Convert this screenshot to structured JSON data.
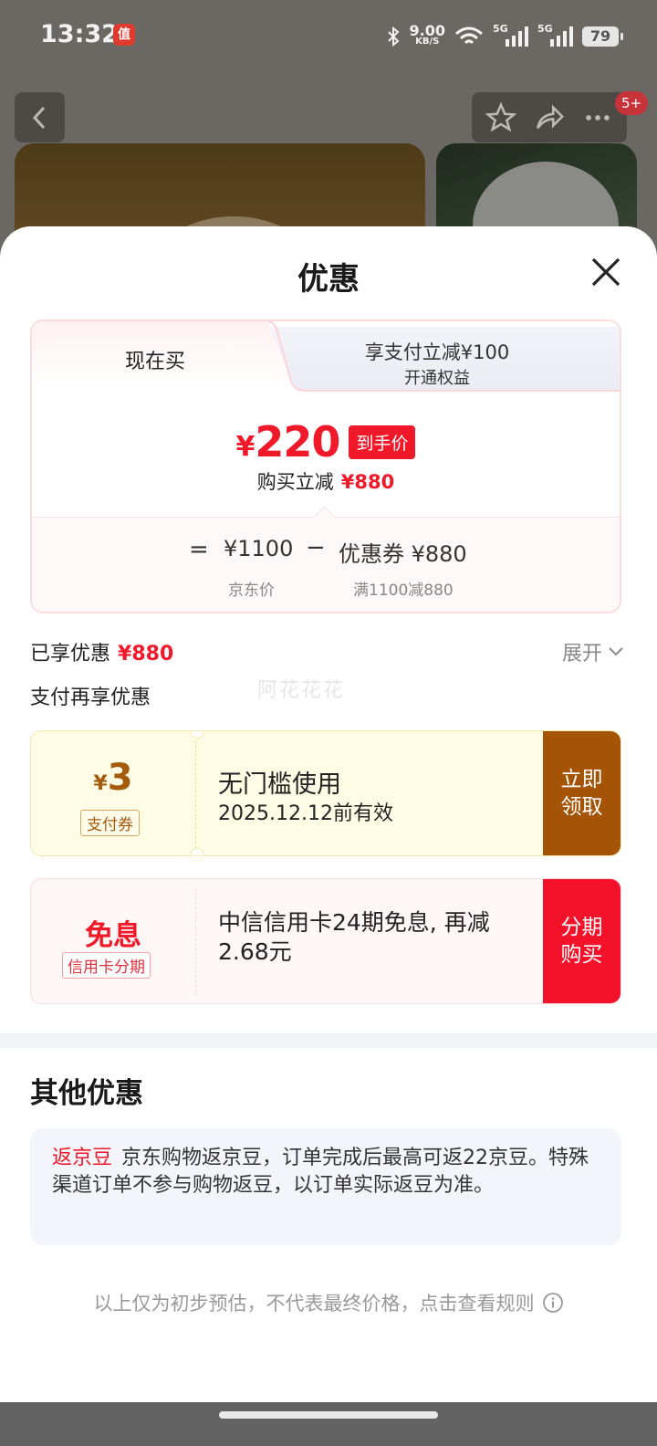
{
  "status_bar": {
    "time": "13:32",
    "app_icon_glyph": "值",
    "net_speed_value": "9.00",
    "net_speed_unit": "KB/S",
    "signal_1_label": "5G",
    "signal_2_label": "5G",
    "battery": "79"
  },
  "background": {
    "cart_badge": "5+"
  },
  "sheet": {
    "title": "优惠",
    "tabs": {
      "active_label": "现在买",
      "inactive_main": "享支付立减¥100",
      "inactive_sub": "开通权益"
    },
    "price": {
      "currency": "¥",
      "amount": "220",
      "tag": "到手价",
      "reduce_label": "购买立减",
      "reduce_amount": "¥880"
    },
    "formula": {
      "equals": "=",
      "jd_price": "¥1100",
      "minus": "−",
      "coupon": "优惠券 ¥880",
      "jd_price_label": "京东价",
      "coupon_label": "满1100减880"
    },
    "enjoyed_label": "已享优惠",
    "enjoyed_amount": "¥880",
    "expand_label": "展开",
    "pay_more_label": "支付再享优惠",
    "watermark": "阿花花花",
    "coupons": [
      {
        "currency": "¥",
        "amount": "3",
        "tag": "支付券",
        "title": "无门槛使用",
        "subtitle": "2025.12.12前有效",
        "button": "立即领取",
        "color": "#a45404"
      },
      {
        "title_left": "免息",
        "tag": "信用卡分期",
        "description": "中信信用卡24期免息, 再减2.68元",
        "button": "分期购买",
        "color": "#f3122a"
      }
    ],
    "other": {
      "title": "其他优惠",
      "highlight": "返京豆",
      "text": "京东购物返京豆，订单完成后最高可返22京豆。特殊渠道订单不参与购物返豆，以订单实际返豆为准。"
    },
    "disclaimer": "以上仅为初步预估，不代表最终价格，点击查看规则"
  },
  "colors": {
    "accent_red": "#f0192a",
    "coupon_brown": "#a45404"
  },
  "icons": [
    "back-icon",
    "star-icon",
    "share-icon",
    "more-icon",
    "close-icon",
    "chevron-down-icon",
    "info-icon"
  ]
}
